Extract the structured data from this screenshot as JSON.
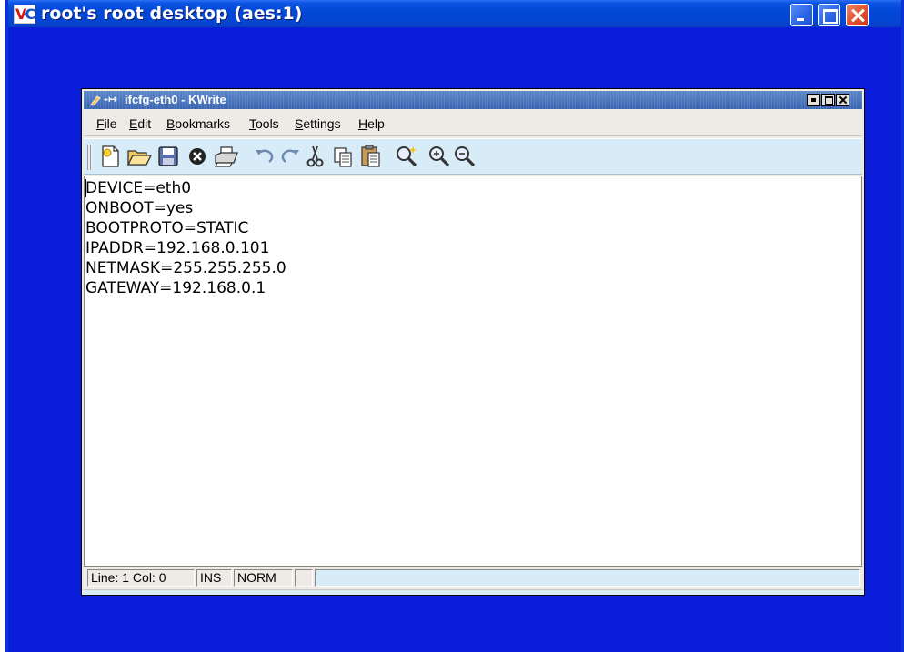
{
  "vnc_window": {
    "title": "root's root desktop (aes:1)",
    "app_icon_letters": [
      "V",
      "C"
    ],
    "controls": [
      "minimize",
      "maximize",
      "close"
    ]
  },
  "kwrite": {
    "title": "ifcfg-eth0 - KWrite",
    "title_glyph": "-↦",
    "menu": [
      {
        "label": "File",
        "accel": "F",
        "rest": "ile"
      },
      {
        "label": "Edit",
        "accel": "E",
        "rest": "dit"
      },
      {
        "label": "Bookmarks",
        "accel": "B",
        "rest": "ookmarks"
      },
      {
        "label": "Tools",
        "accel": "T",
        "rest": "ools"
      },
      {
        "label": "Settings",
        "accel": "S",
        "rest": "ettings"
      },
      {
        "label": "Help",
        "accel": "H",
        "rest": "elp"
      }
    ],
    "toolbar_icons": [
      "new-document-icon",
      "open-folder-icon",
      "save-disk-icon",
      "close-document-icon",
      "print-icon",
      "undo-icon",
      "redo-icon",
      "cut-icon",
      "copy-icon",
      "paste-icon",
      "find-icon",
      "zoom-in-icon",
      "zoom-out-icon"
    ],
    "document_lines": [
      "DEVICE=eth0",
      "ONBOOT=yes",
      "BOOTPROTO=STATIC",
      "IPADDR=192.168.0.101",
      "NETMASK=255.255.255.0",
      "GATEWAY=192.168.0.1"
    ],
    "status": {
      "position": "Line: 1 Col: 0",
      "mode": "INS",
      "edit_mode": "NORM",
      "extra": ""
    }
  },
  "colors": {
    "desktop_bg": "#0a1ed9",
    "xp_title": "#0348d6",
    "kwrite_title": "#4a77bd",
    "toolbar_bg": "#d8ecf8"
  }
}
